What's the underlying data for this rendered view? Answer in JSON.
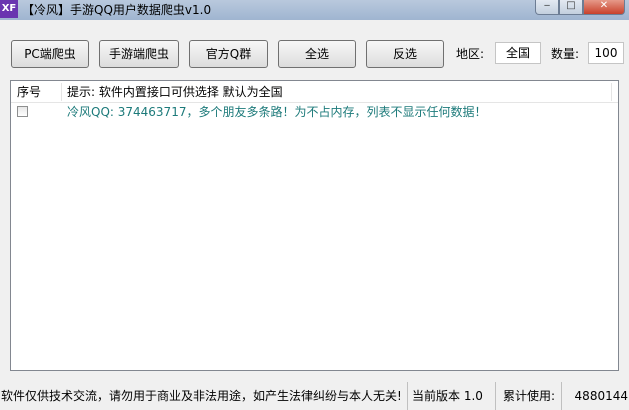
{
  "window": {
    "icon_text": "XF",
    "title": "【冷风】手游QQ用户数据爬虫v1.0",
    "min_glyph": "‒",
    "max_glyph": "□",
    "close_glyph": "✕"
  },
  "toolbar": {
    "pc_crawler": "PC端爬虫",
    "mobile_crawler": "手游端爬虫",
    "official_qq_group": "官方Q群",
    "select_all": "全选",
    "invert_selection": "反选",
    "region_label": "地区:",
    "region_value": "全国",
    "quantity_label": "数量:",
    "quantity_value": "100"
  },
  "list": {
    "columns": [
      "序号",
      "提示: 软件内置接口可供选择 默认为全国"
    ],
    "rows": [
      {
        "checked": false,
        "text": "冷风QQ: 374463717，多个朋友多条路！为不占内存，列表不显示任何数据！"
      }
    ]
  },
  "statusbar": {
    "disclaimer": "软件仅供技术交流，请勿用于商业及非法用途，如产生法律纠纷与本人无关!",
    "version": "当前版本 1.0",
    "total_label": "累计使用:",
    "total_value": "4880144"
  }
}
